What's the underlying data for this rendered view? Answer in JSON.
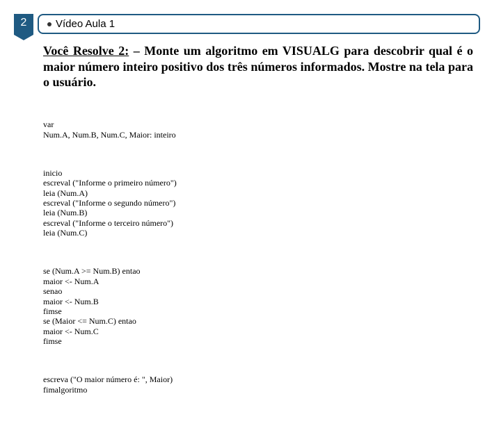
{
  "header": {
    "badge_number": "2",
    "title": "Vídeo Aula 1"
  },
  "problem": {
    "lead": "Você Resolve 2:",
    "text": " – Monte um algoritmo em VISUALG para descobrir qual é o maior número inteiro positivo dos três números informados. Mostre na tela para o usuário."
  },
  "code": {
    "block1": "var\nNum.A, Num.B, Num.C, Maior: inteiro",
    "block2": "inicio\nescreval (\"Informe o primeiro número\")\nleia (Num.A)\nescreval (\"Informe o segundo número\")\nleia (Num.B)\nescreval (\"Informe o terceiro número\")\nleia (Num.C)",
    "block3": "se (Num.A >= Num.B) entao\nmaior <- Num.A\nsenao\nmaior <- Num.B\nfimse\nse (Maior <= Num.C) entao\nmaior <- Num.C\nfimse",
    "block4": "escreva (\"O maior número é: \", Maior)\nfimalgoritmo"
  }
}
